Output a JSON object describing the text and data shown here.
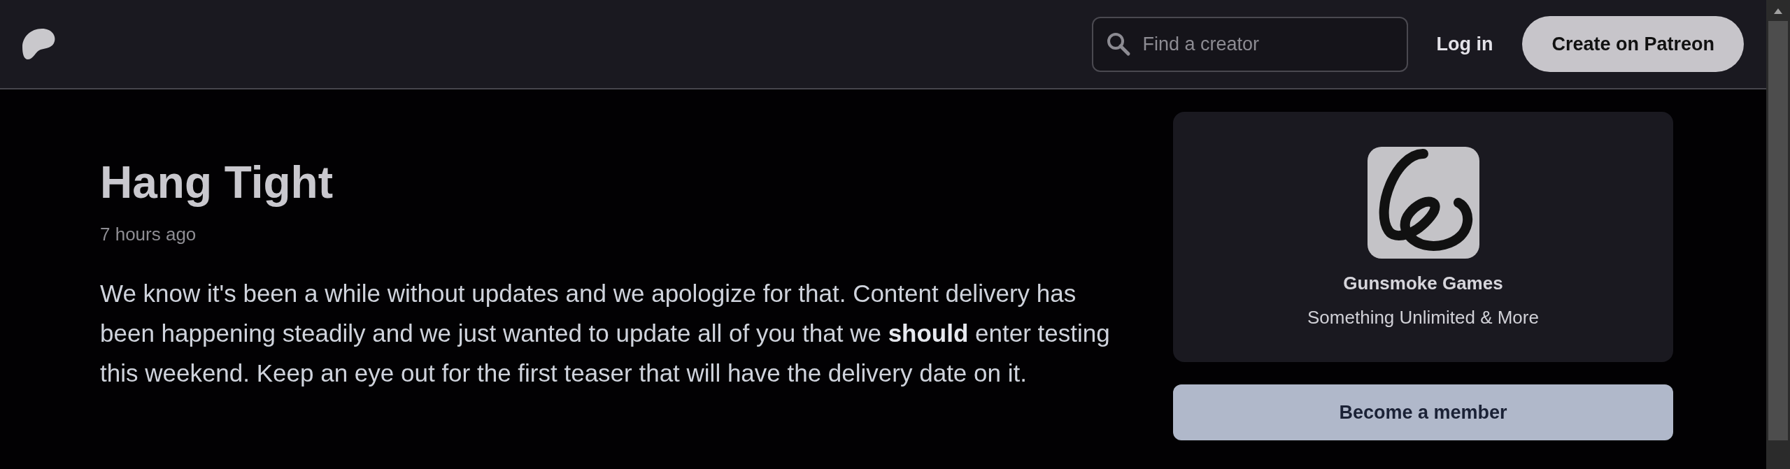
{
  "header": {
    "search": {
      "placeholder": "Find a creator"
    },
    "login": "Log in",
    "create_button": "Create on Patreon"
  },
  "post": {
    "title": "Hang Tight",
    "time": "7 hours ago",
    "body": "We know it's been a while without updates and we apologize for that. Content delivery has been happening steadily and we just wanted to update all of you that we **should** enter testing this weekend. Keep an eye out for the first teaser that will have the delivery date on it."
  },
  "creator": {
    "name": "Gunsmoke Games",
    "tagline": "Something Unlimited & More",
    "join_button": "Become a member"
  }
}
